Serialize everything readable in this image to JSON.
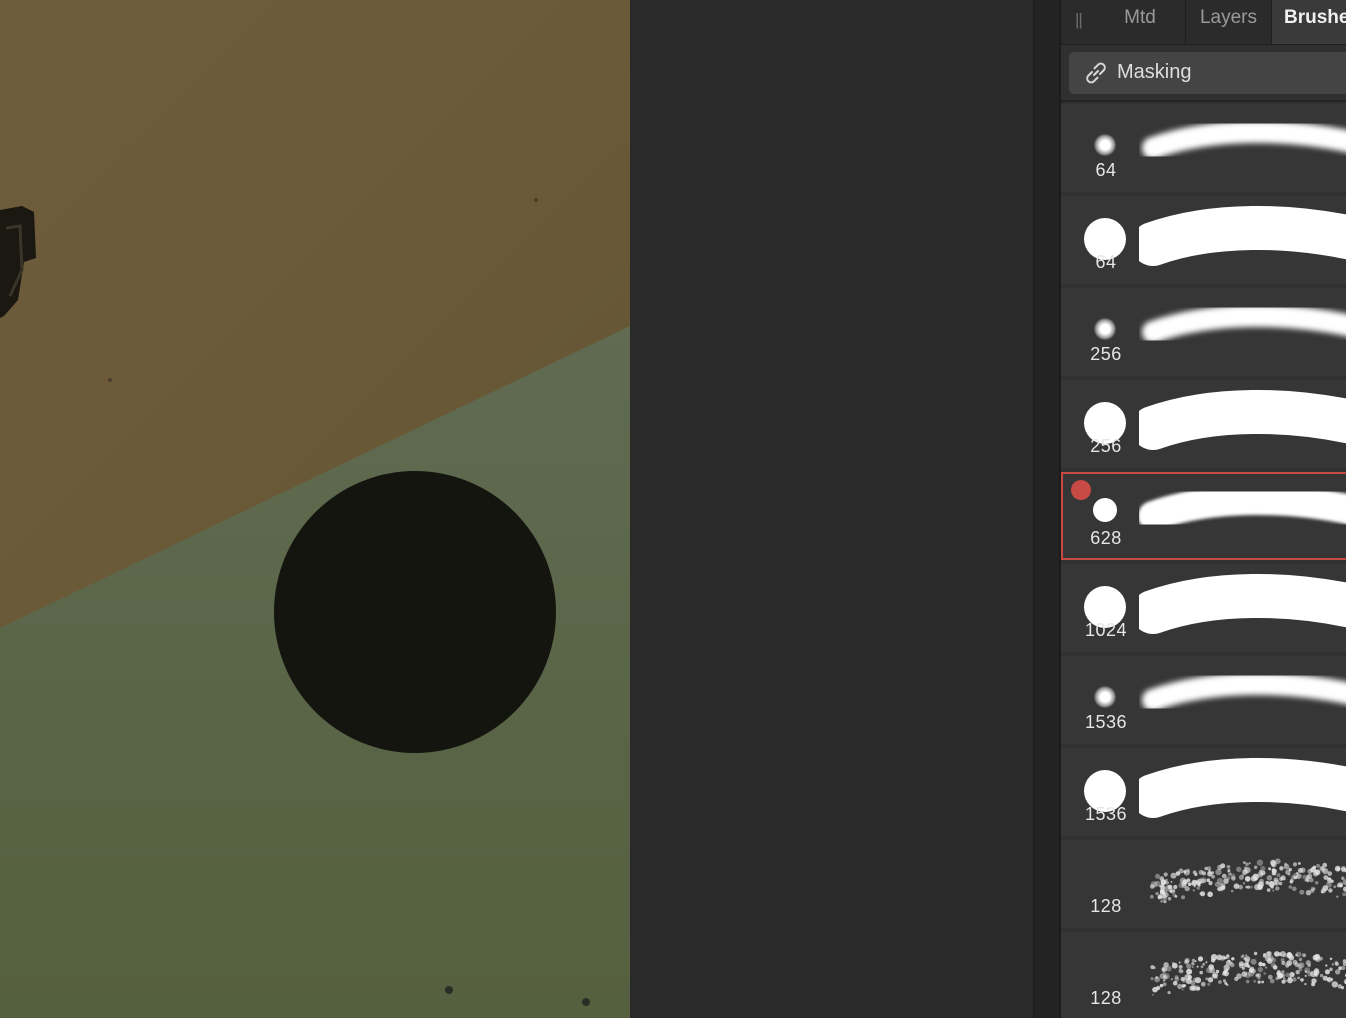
{
  "panel": {
    "tabs": [
      {
        "label": "Mtd",
        "active": false
      },
      {
        "label": "Layers",
        "active": false
      },
      {
        "label": "Brushes",
        "active": true
      }
    ],
    "masking_label": "Masking"
  },
  "brushes": [
    {
      "size": "64",
      "tip": "soft",
      "stroke": "soft",
      "selected": false
    },
    {
      "size": "64",
      "tip": "hard",
      "stroke": "hard",
      "selected": false
    },
    {
      "size": "256",
      "tip": "soft",
      "stroke": "soft",
      "selected": false
    },
    {
      "size": "256",
      "tip": "hard",
      "stroke": "hard",
      "selected": false
    },
    {
      "size": "628",
      "tip": "mid",
      "stroke": "medium",
      "selected": true
    },
    {
      "size": "1024",
      "tip": "hard",
      "stroke": "hard",
      "selected": false
    },
    {
      "size": "1536",
      "tip": "soft",
      "stroke": "soft",
      "selected": false
    },
    {
      "size": "1536",
      "tip": "hard",
      "stroke": "hard",
      "selected": false
    },
    {
      "size": "128",
      "tip": "none",
      "stroke": "texture",
      "selected": false
    },
    {
      "size": "128",
      "tip": "none",
      "stroke": "texture2",
      "selected": false
    }
  ],
  "colors": {
    "canvas_upper": "#6b5a3a",
    "canvas_lower": "#5a6249",
    "mask_circle": "#14150f",
    "selection_accent": "#c84a44",
    "panel_bg": "#303030",
    "brush_row_bg": "#363636"
  },
  "icons": {
    "masking": "link-icon",
    "panel_grip": "grip-icon",
    "selected_marker": "dot-icon"
  }
}
